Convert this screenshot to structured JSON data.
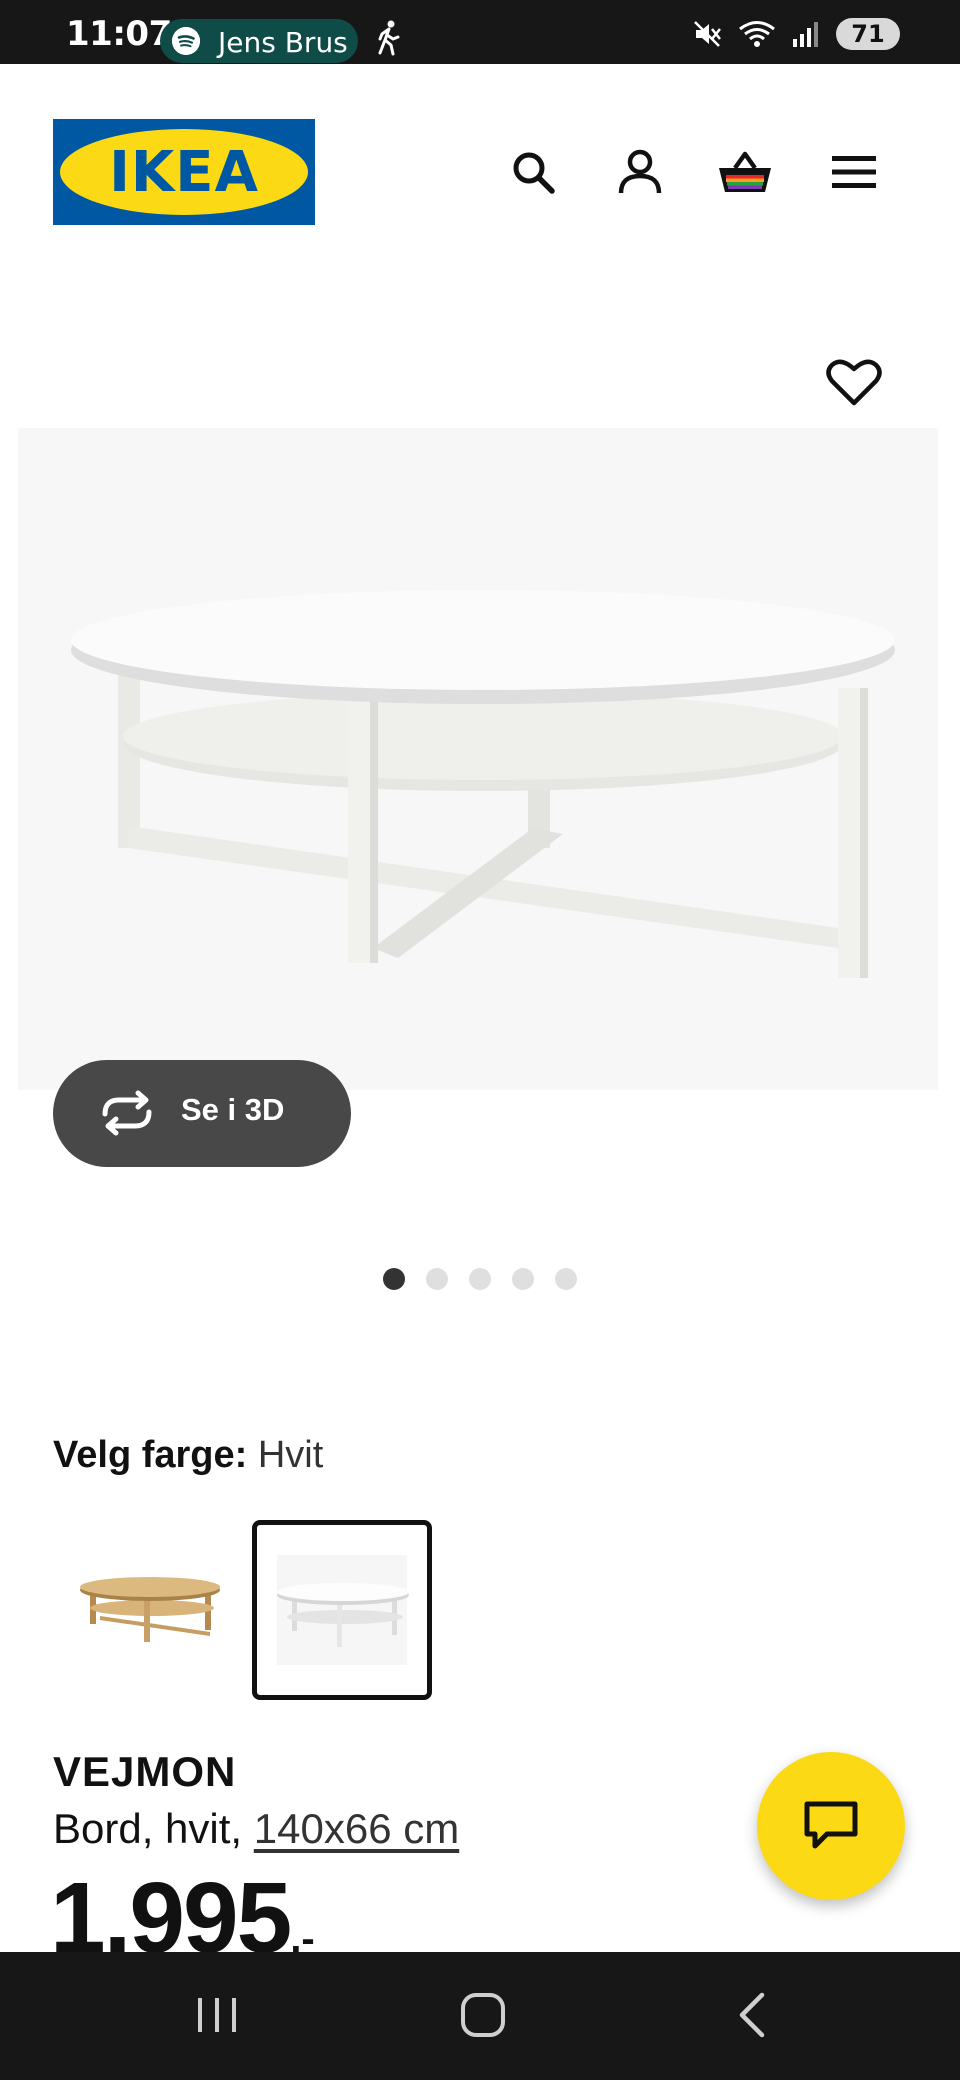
{
  "status_bar": {
    "time": "11:07",
    "media_pill": {
      "text": "Jens Brus",
      "icon": "spotify-icon"
    },
    "battery": "71",
    "icons": [
      "walk-icon",
      "mute-icon",
      "wifi-icon",
      "signal-icon",
      "battery-icon"
    ]
  },
  "header": {
    "logo_text": "IKEA",
    "icons": [
      "search-icon",
      "account-icon",
      "basket-icon",
      "menu-icon"
    ]
  },
  "gallery": {
    "view_3d_label": "Se i 3D",
    "image_count": 5,
    "active_index": 0
  },
  "color": {
    "label": "Velg farge:",
    "selected": "Hvit",
    "swatches": [
      {
        "name": "oak",
        "selected": false
      },
      {
        "name": "white",
        "selected": true
      }
    ]
  },
  "product": {
    "name": "VEJMON",
    "description": "Bord, hvit, ",
    "size_link": "140x66 cm",
    "price": "1.995",
    "price_suffix": ",-"
  },
  "colors": {
    "ikea_blue": "#0058a3",
    "ikea_yellow": "#fbd914",
    "status_bar": "#171717",
    "button_dark": "#484848"
  }
}
